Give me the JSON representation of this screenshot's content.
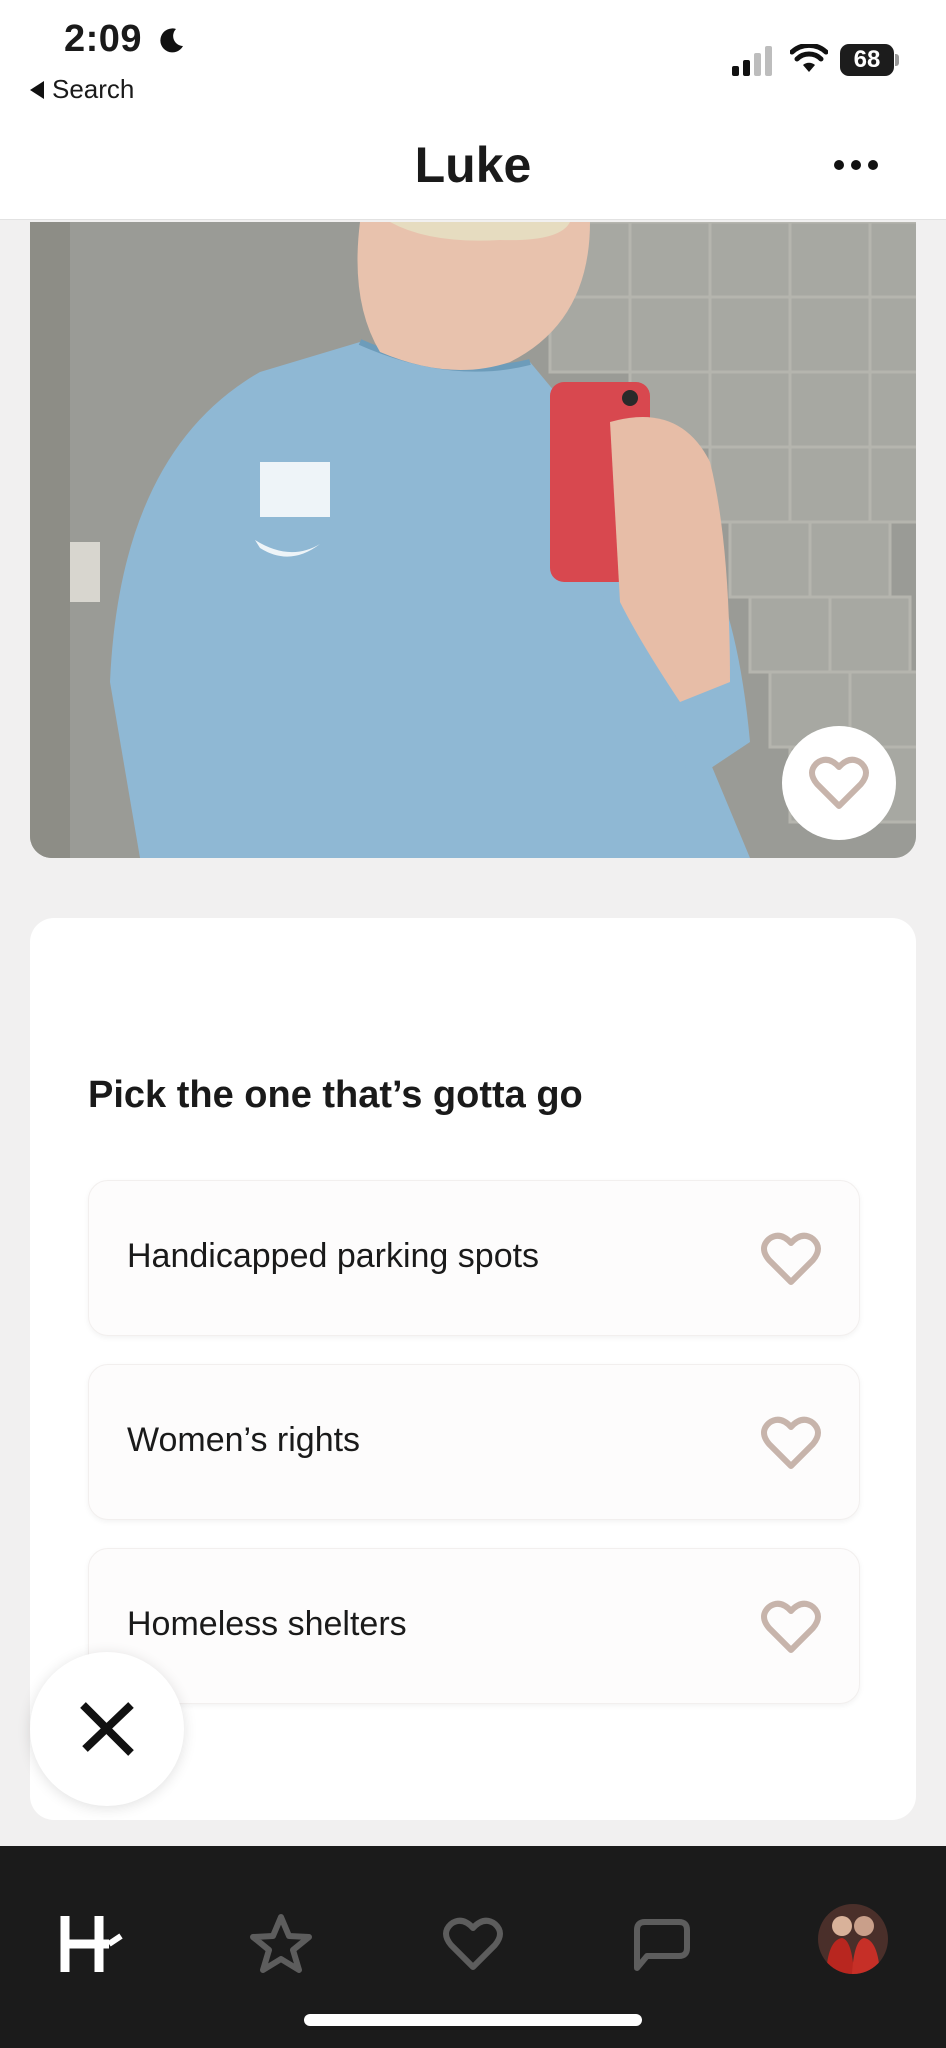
{
  "status_bar": {
    "time": "2:09",
    "back_label": "Search",
    "battery": "68"
  },
  "header": {
    "title": "Luke"
  },
  "prompt": {
    "question": "Pick the one that’s gotta go",
    "options": [
      {
        "label": "Handicapped parking spots"
      },
      {
        "label": "Women’s rights"
      },
      {
        "label": "Homeless shelters"
      }
    ]
  },
  "nav": {
    "items": [
      "home-logo",
      "star-icon",
      "heart-icon",
      "chat-icon",
      "profile-avatar"
    ],
    "active": "home-logo"
  },
  "colors": {
    "heart_outline": "#c7b4ab",
    "nav_background": "#1b1b1b",
    "shirt": "#8fb8d4",
    "phone": "#d8484f"
  }
}
